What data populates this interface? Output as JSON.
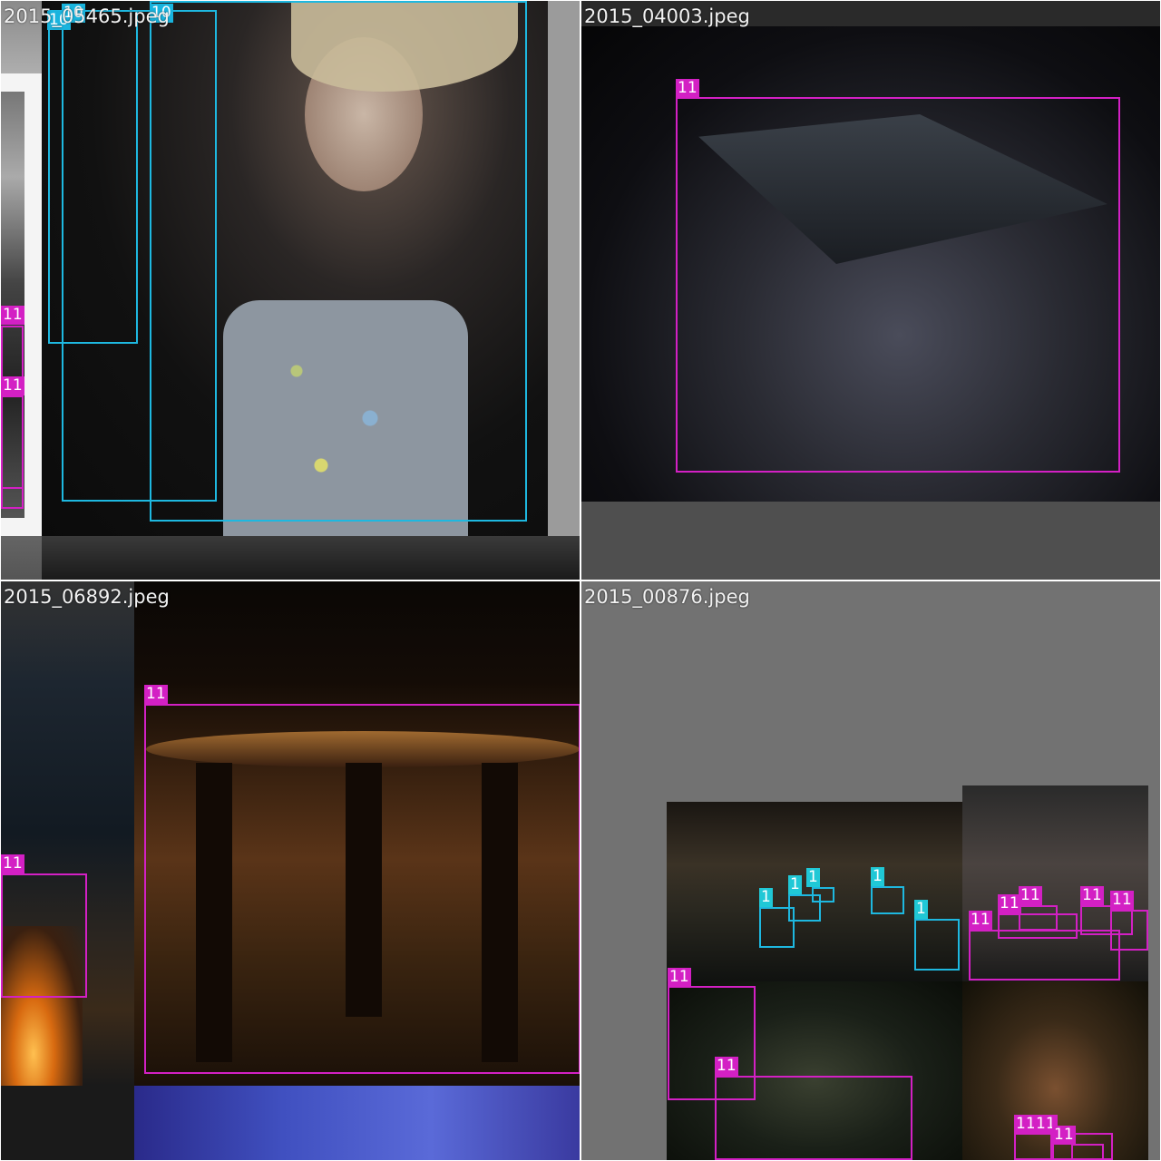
{
  "tiles": [
    {
      "filename": "2015_05465.jpeg",
      "labels": [
        "10",
        "10",
        "10",
        "11",
        "11"
      ]
    },
    {
      "filename": "2015_04003.jpeg",
      "labels": [
        "11"
      ]
    },
    {
      "filename": "2015_06892.jpeg",
      "labels": [
        "11",
        "11"
      ]
    },
    {
      "filename": "2015_00876.jpeg",
      "labels": [
        "1",
        "1",
        "1",
        "1",
        "1",
        "11",
        "11",
        "11",
        "11",
        "11",
        "11",
        "11",
        "11",
        "11",
        "11"
      ]
    }
  ],
  "colors": {
    "class_10": "#1eb8e0",
    "class_11": "#d320c4",
    "class_1": "#20c8d6",
    "filler_gray": "#727272"
  }
}
